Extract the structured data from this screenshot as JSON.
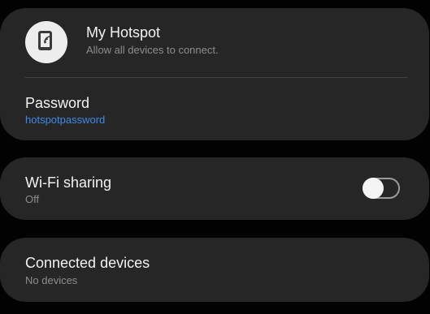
{
  "hotspot": {
    "title": "My Hotspot",
    "subtitle": "Allow all devices to connect.",
    "icon": "hotspot-icon"
  },
  "password": {
    "label": "Password",
    "value": "hotspotpassword",
    "value_color": "#3f8ae6"
  },
  "wifi_sharing": {
    "label": "Wi-Fi sharing",
    "status": "Off",
    "enabled": false
  },
  "connected_devices": {
    "label": "Connected devices",
    "status": "No devices"
  },
  "colors": {
    "background": "#020202",
    "card": "#262626",
    "title_text": "#f2f2f2",
    "secondary_text": "#8d8d8d",
    "accent": "#3f8ae6"
  }
}
